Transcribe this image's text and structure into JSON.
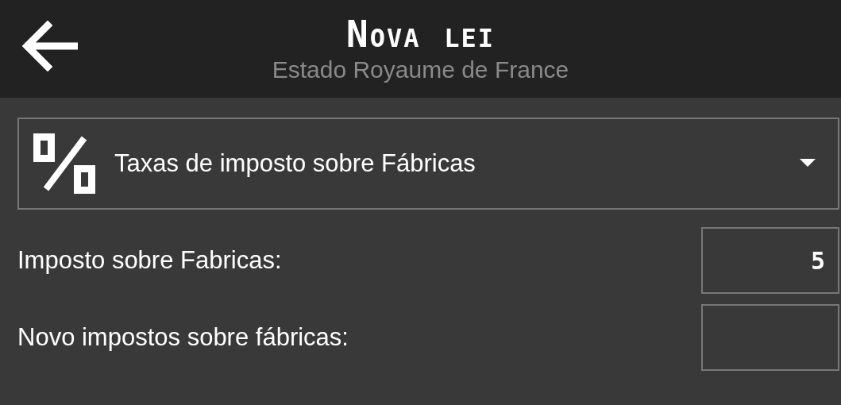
{
  "header": {
    "title": "Nova lei",
    "subtitle": "Estado Royaume de France"
  },
  "law_type": {
    "value": "Taxas de imposto sobre Fábricas"
  },
  "fields": [
    {
      "label": "Imposto sobre Fabricas:",
      "value": "5"
    },
    {
      "label": "Novo impostos sobre fábricas:"
    }
  ]
}
